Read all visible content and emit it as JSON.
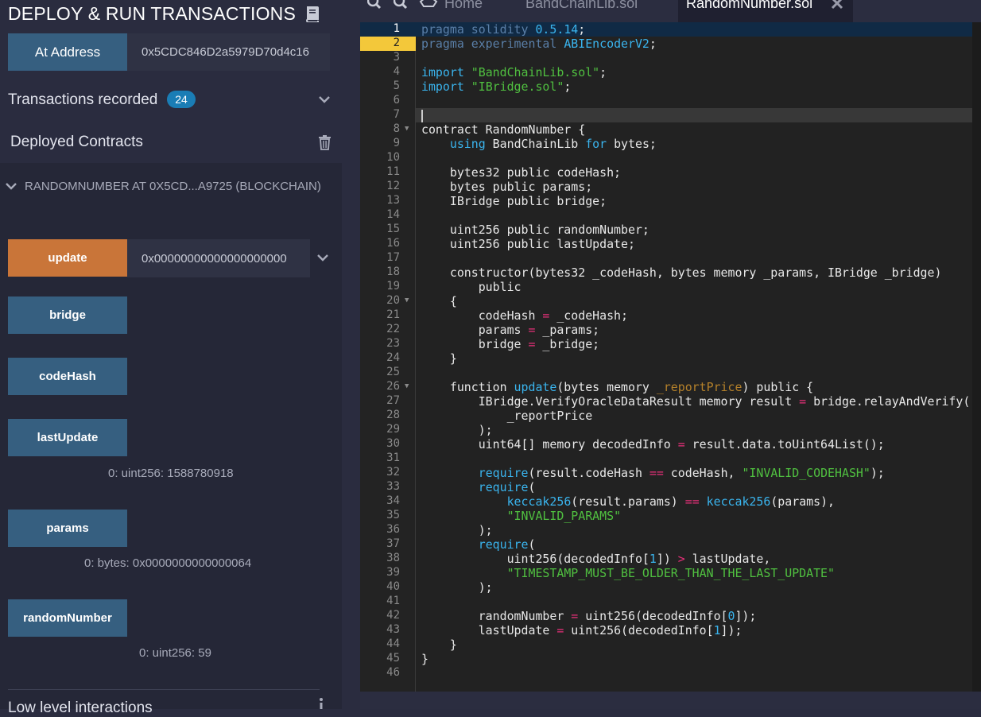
{
  "panel": {
    "title": "DEPLOY & RUN TRANSACTIONS",
    "at_address_label": "At Address",
    "at_address_value": "0x5CDC846D2a5979D70d4c16",
    "transactions_label": "Transactions recorded",
    "transactions_count": "24",
    "deployed_label": "Deployed Contracts",
    "instance_label": "RANDOMNUMBER AT 0X5CD...A9725 (BLOCKCHAIN)",
    "functions": [
      {
        "label": "update",
        "input": "0x00000000000000000000"
      },
      {
        "label": "bridge"
      },
      {
        "label": "codeHash"
      },
      {
        "label": "lastUpdate",
        "result": "0: uint256: 1588780918"
      },
      {
        "label": "params",
        "result": "0: bytes: 0x0000000000000064"
      },
      {
        "label": "randomNumber",
        "result": "0: uint256: 59"
      }
    ],
    "low_level_label": "Low level interactions"
  },
  "editor": {
    "tabs": [
      "Home",
      "BandChainLib.sol",
      "RandomNumber.sol"
    ],
    "active_tab": "RandomNumber.sol"
  },
  "colors": {
    "accent_blue": "#365f80",
    "accent_orange": "#c97539",
    "badge": "#1a7db5"
  }
}
